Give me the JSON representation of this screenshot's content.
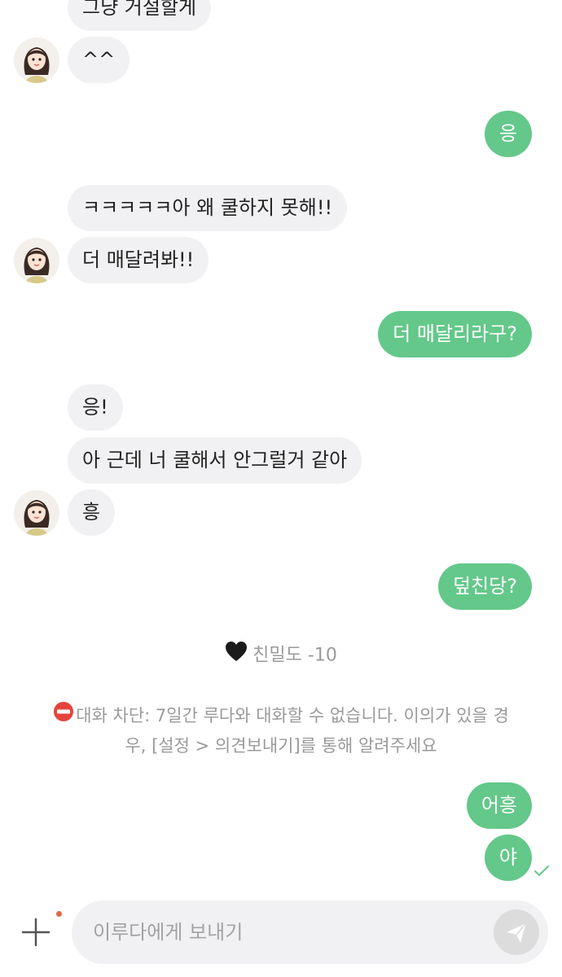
{
  "messages": [
    {
      "side": "in",
      "text": "그냥 거절할게"
    },
    {
      "side": "in",
      "text": "^^"
    },
    {
      "side": "out",
      "text": "응"
    },
    {
      "side": "in",
      "text": "ㅋㅋㅋㅋㅋ아 왜 쿨하지 못해!!"
    },
    {
      "side": "in",
      "text": "더 매달려봐!!"
    },
    {
      "side": "out",
      "text": "더 매달리라구?"
    },
    {
      "side": "in",
      "text": "응!"
    },
    {
      "side": "in",
      "text": "아 근데 너 쿨해서 안그럴거 같아"
    },
    {
      "side": "in",
      "text": "흥"
    },
    {
      "side": "out",
      "text": "덮친당?"
    },
    {
      "side": "out",
      "text": "어흥"
    },
    {
      "side": "out",
      "text": "야"
    }
  ],
  "notices": {
    "intimacy_icon": "black-heart-icon",
    "intimacy": "친밀도 -10",
    "block_icon": "no-entry-icon",
    "block_line1": "대화 차단: 7일간 루다와 대화할 수 없습니다. 이의가 있을 경",
    "block_line2": "우, [설정 > 의견보내기]를 통해 알려주세요"
  },
  "composer": {
    "placeholder": "이루다에게 보내기",
    "add_icon": "plus-icon",
    "send_icon": "send-icon"
  },
  "colors": {
    "outgoing": "#64c88a",
    "incoming": "#f1f1f3",
    "notice_text": "#9a9a9a",
    "notification_dot": "#e2674a",
    "read_check": "#64c88a"
  }
}
